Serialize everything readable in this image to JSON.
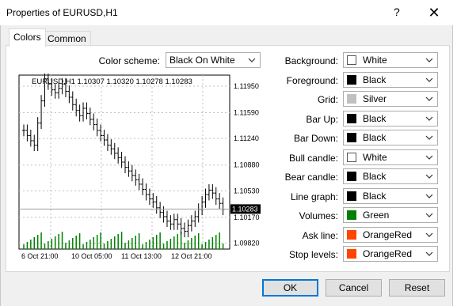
{
  "window": {
    "title": "Properties of EURUSD,H1",
    "help_glyph": "?",
    "close_glyph": "✕"
  },
  "tabs": [
    {
      "label": "Colors",
      "active": true
    },
    {
      "label": "Common",
      "active": false
    }
  ],
  "color_scheme": {
    "label": "Color scheme:",
    "value": "Black On White"
  },
  "colors": [
    {
      "label": "Background:",
      "value": "White",
      "swatch": "#ffffff"
    },
    {
      "label": "Foreground:",
      "value": "Black",
      "swatch": "#000000"
    },
    {
      "label": "Grid:",
      "value": "Silver",
      "swatch": "#c0c0c0"
    },
    {
      "label": "Bar Up:",
      "value": "Black",
      "swatch": "#000000"
    },
    {
      "label": "Bar Down:",
      "value": "Black",
      "swatch": "#000000"
    },
    {
      "label": "Bull candle:",
      "value": "White",
      "swatch": "#ffffff"
    },
    {
      "label": "Bear candle:",
      "value": "Black",
      "swatch": "#000000"
    },
    {
      "label": "Line graph:",
      "value": "Black",
      "swatch": "#000000"
    },
    {
      "label": "Volumes:",
      "value": "Green",
      "swatch": "#008000"
    },
    {
      "label": "Ask line:",
      "value": "OrangeRed",
      "swatch": "#ff4500"
    },
    {
      "label": "Stop levels:",
      "value": "OrangeRed",
      "swatch": "#ff4500"
    }
  ],
  "preview": {
    "header": "EURUSD,H1  1.10307 1.10320 1.10278 1.10283",
    "price_ticks": [
      "1.11950",
      "1.11590",
      "1.11240",
      "1.10880",
      "1.10530",
      "1.10170",
      "1.09820"
    ],
    "price_tick_values": [
      1.1195,
      1.1159,
      1.1124,
      1.1088,
      1.1053,
      1.1017,
      1.0982
    ],
    "current_price": "1.10283",
    "current_price_value": 1.10283,
    "time_ticks": [
      "6 Oct 21:00",
      "10 Oct 05:00",
      "11 Oct 13:00",
      "12 Oct 21:00"
    ],
    "close_series": [
      1.1135,
      1.1128,
      1.1121,
      1.1115,
      1.1145,
      1.1175,
      1.1205,
      1.1198,
      1.119,
      1.1186,
      1.1192,
      1.1198,
      1.1188,
      1.118,
      1.117,
      1.1162,
      1.1155,
      1.1165,
      1.1158,
      1.115,
      1.1143,
      1.1135,
      1.1128,
      1.1122,
      1.1115,
      1.111,
      1.1104,
      1.1098,
      1.1092,
      1.1085,
      1.108,
      1.1074,
      1.1068,
      1.1062,
      1.1055,
      1.1048,
      1.1042,
      1.1038,
      1.103,
      1.1024,
      1.1018,
      1.1012,
      1.1008,
      1.1014,
      1.1008,
      1.1002,
      1.0998,
      1.1006,
      1.1012,
      1.1018,
      1.1028,
      1.1038,
      1.1048,
      1.1054,
      1.105,
      1.1042,
      1.1036,
      1.1028
    ]
  },
  "buttons": {
    "ok": "OK",
    "cancel": "Cancel",
    "reset": "Reset"
  }
}
